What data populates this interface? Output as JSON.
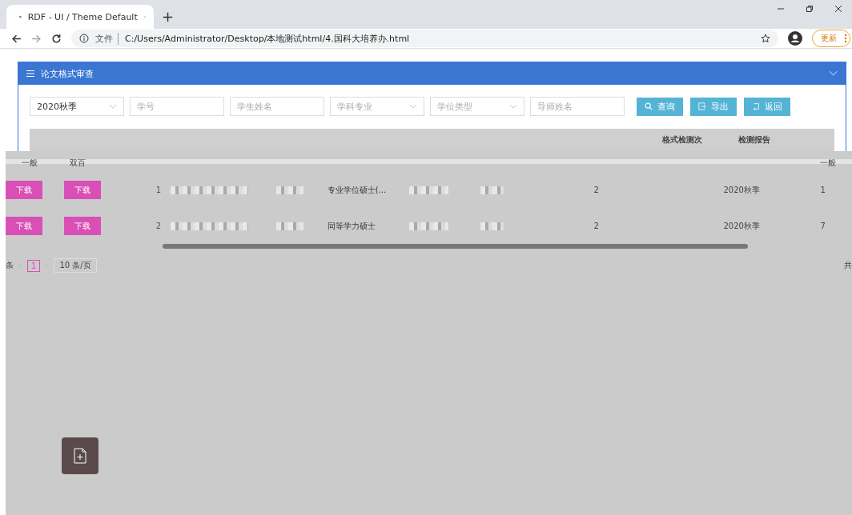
{
  "browser": {
    "tab_title": "RDF - UI / Theme Default",
    "new_tab": "+",
    "address_label": "文件",
    "url": "C:/Users/Administrator/Desktop/本地测试html/4.国科大培养办.html",
    "update_button": "更新"
  },
  "panel": {
    "title": "论文格式审查"
  },
  "filters": [
    {
      "kind": "select",
      "value": "2020秋季"
    },
    {
      "kind": "input",
      "placeholder": "学号"
    },
    {
      "kind": "input",
      "placeholder": "学生姓名"
    },
    {
      "kind": "select",
      "placeholder": "学科专业"
    },
    {
      "kind": "select",
      "placeholder": "学位类型"
    },
    {
      "kind": "input",
      "placeholder": "导师姓名"
    }
  ],
  "buttons": [
    {
      "kind": "search",
      "label": "查询"
    },
    {
      "kind": "export",
      "label": "导出"
    },
    {
      "kind": "back",
      "label": "返回"
    }
  ],
  "table": {
    "header_labels": [
      "格式检测次",
      "检测报告"
    ],
    "sub_header": [
      "一般",
      "双百"
    ],
    "sub_header_right": "一般",
    "rows": [
      {
        "downloads": [
          "下载",
          "下载"
        ],
        "index": "1",
        "degree_type": "专业学位硕士(...",
        "count": "2",
        "semester": "2020秋季",
        "number": "1"
      },
      {
        "downloads": [
          "下载",
          "下载"
        ],
        "index": "2",
        "degree_type": "同等学力硕士",
        "count": "2",
        "semester": "2020秋季",
        "number": "7"
      }
    ]
  },
  "pagination": {
    "prefix": "条",
    "pages": [
      {
        "label": "1",
        "selected": true
      }
    ],
    "page_size": "10 条/页",
    "total": "共"
  }
}
